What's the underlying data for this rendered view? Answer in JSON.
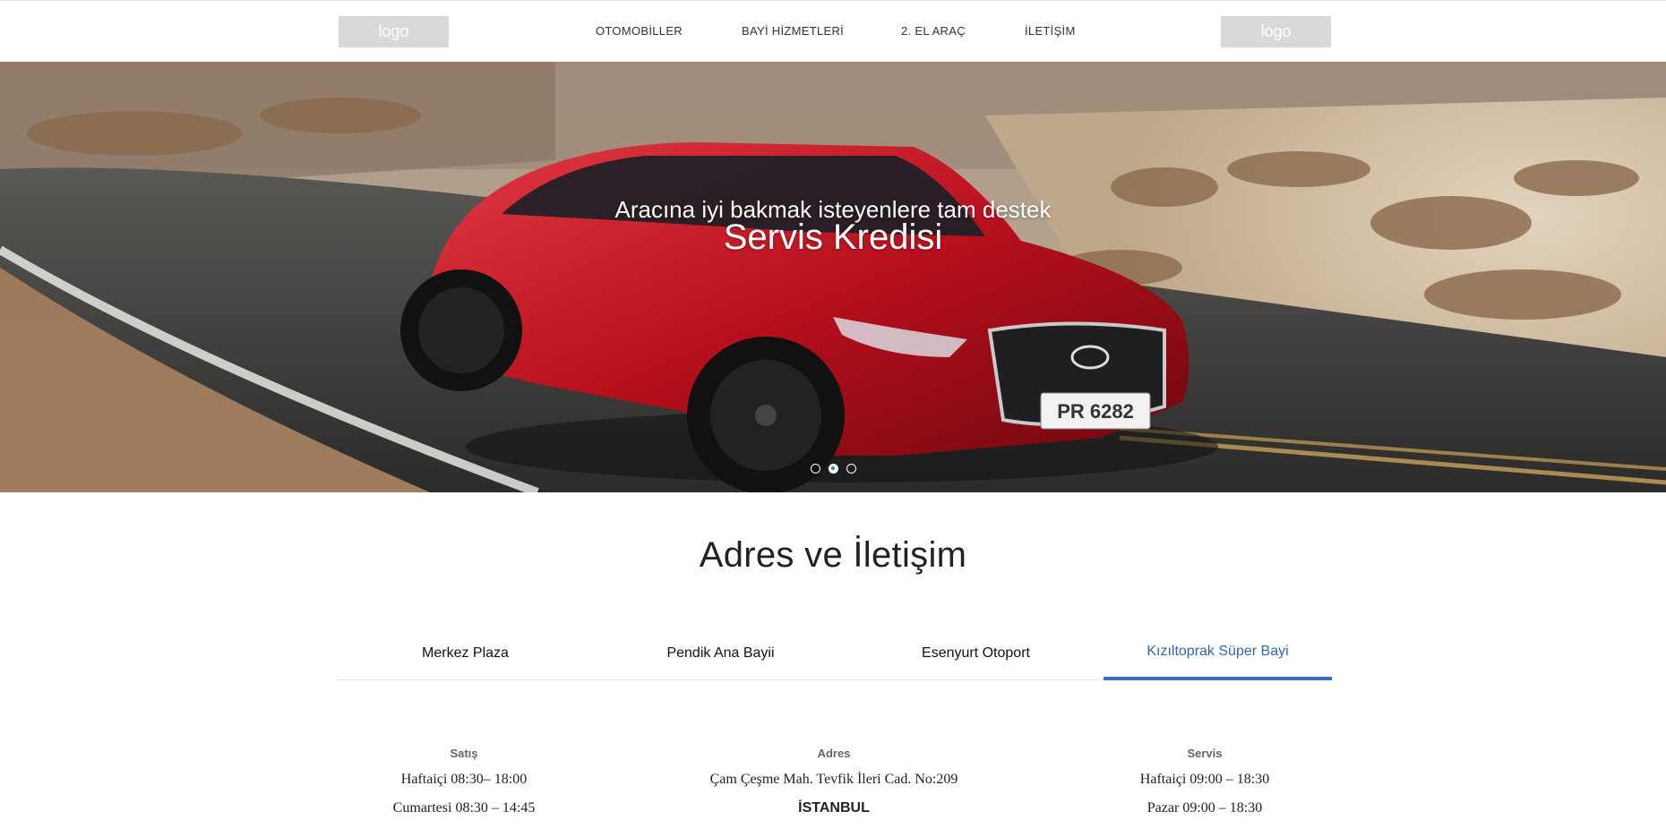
{
  "header": {
    "logo_left": "logo",
    "logo_right": "logo",
    "nav": [
      "OTOMOBİLLER",
      "BAYİ HİZMETLERİ",
      "2. EL ARAÇ",
      "İLETİŞİM"
    ]
  },
  "hero": {
    "subtitle": "Aracına iyi bakmak isteyenlere tam destek",
    "title": "Servis Kredisi",
    "plate": "PR 6282",
    "slides": 3,
    "active_slide": 2,
    "accent_color": "#3c78c4"
  },
  "section": {
    "title": "Adres ve İletişim",
    "tabs": [
      "Merkez Plaza",
      "Pendik Ana Bayii",
      "Esenyurt Otoport",
      "Kızıltoprak Süper Bayi"
    ],
    "active_tab": 4,
    "active_color": "#2f68b0"
  },
  "info": {
    "sales": {
      "heading": "Satış",
      "lines": [
        "Haftaiçi 08:30– 18:00",
        "Cumartesi 08:30 – 14:45"
      ]
    },
    "address": {
      "heading": "Adres",
      "lines": [
        "Çam Çeşme Mah. Tevfik İleri Cad. No:209",
        "İSTANBUL"
      ]
    },
    "service": {
      "heading": "Servis",
      "lines": [
        "Haftaiçi 09:00 – 18:30",
        "Pazar 09:00 – 18:30"
      ]
    }
  }
}
